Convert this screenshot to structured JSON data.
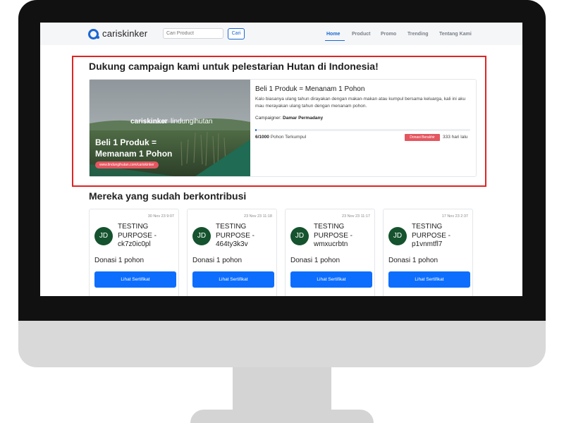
{
  "navbar": {
    "brand": "cariskinker",
    "search_placeholder": "Cari Product",
    "search_button": "Cari",
    "menu": [
      "Home",
      "Product",
      "Promo",
      "Trending",
      "Tentang Kami"
    ],
    "active_menu": "Home"
  },
  "campaign": {
    "heading": "Dukung campaign kami untuk pelestarian Hutan di Indonesia!",
    "banner": {
      "brand_left": "cariskinker",
      "brand_separator": "x",
      "brand_right": "lindungihutan",
      "headline_line1": "Beli 1 Produk =",
      "headline_line2": "Memanam 1 Pohon",
      "url": "www.lindungihutan.com/cariskinker"
    },
    "title": "Beli 1 Produk = Menanam 1 Pohon",
    "description": "Kalo biasanya ulang tahun dirayakan dengan makan-makan atau kumpul bersama keluarga, kali ini aku mau merayakan ulang tahun dengan menanam pohon.",
    "campaigner_label": "Campaigner:",
    "campaigner_name": "Damar Permadany",
    "progress_fraction": 0.006,
    "progress_count": "6/1000",
    "progress_suffix": "Pohon Terkumpul",
    "status_badge": "Donasi Berakhir",
    "time_ago": "333 hari lalu",
    "colors": {
      "highlight_border": "#e02424",
      "accent": "#1a67d2",
      "badge": "#e45660"
    }
  },
  "contributors": {
    "heading": "Mereka yang sudah berkontribusi",
    "items": [
      {
        "date": "30 Nov 23 9:07",
        "initials": "JD",
        "name": "TESTING PURPOSE - ck7z0ic0pl",
        "donation": "Donasi 1 pohon",
        "button": "Lihat Sertifikat"
      },
      {
        "date": "23 Nov 23 11:18",
        "initials": "JD",
        "name": "TESTING PURPOSE - 464ty3k3v",
        "donation": "Donasi 1 pohon",
        "button": "Lihat Sertifikat"
      },
      {
        "date": "23 Nov 23 11:17",
        "initials": "JD",
        "name": "TESTING PURPOSE - wmxucrbtn",
        "donation": "Donasi 1 pohon",
        "button": "Lihat Sertifikat"
      },
      {
        "date": "17 Nov 23 2:37",
        "initials": "JD",
        "name": "TESTING PURPOSE - p1vnmtfl7",
        "donation": "Donasi 1 pohon",
        "button": "Lihat Sertifikat"
      }
    ]
  }
}
